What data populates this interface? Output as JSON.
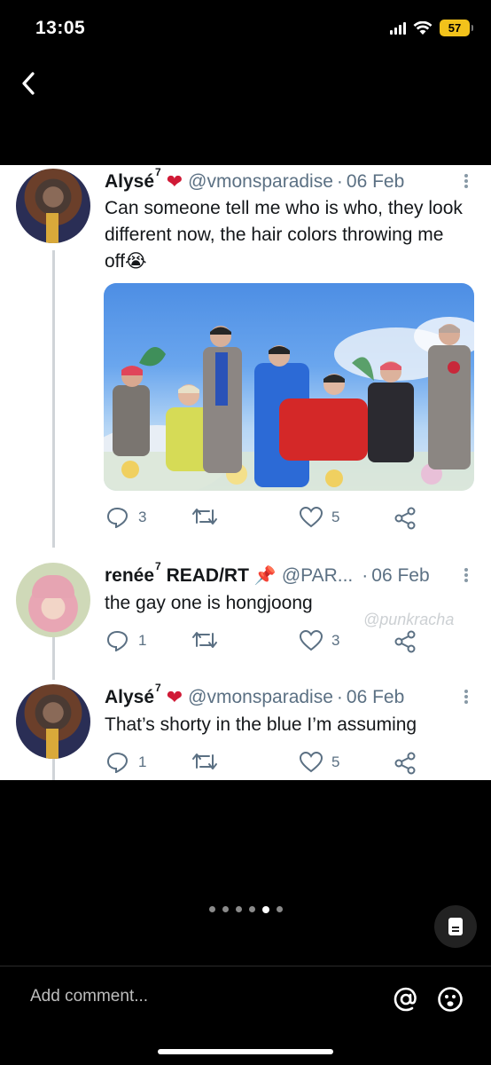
{
  "status_bar": {
    "time": "13:05",
    "battery": "57"
  },
  "tweets": [
    {
      "name": "Alysé",
      "name_sup": "7",
      "badge": "heart",
      "handle": "@vmonsparadise",
      "separator": "·",
      "date": "06 Feb",
      "text": "Can someone tell me who is who, they look different now, the hair colors throwing me off😭",
      "replies": "3",
      "likes": "5"
    },
    {
      "name": "renée",
      "name_sup": "7",
      "name_rest": " READ/RT",
      "badge": "pin",
      "handle": "@PAR...",
      "separator": "·",
      "date": "06 Feb",
      "text": "the gay one is hongjoong",
      "replies": "1",
      "likes": "3"
    },
    {
      "name": "Alysé",
      "name_sup": "7",
      "badge": "heart",
      "handle": "@vmonsparadise",
      "separator": "·",
      "date": "06 Feb",
      "text": "That’s shorty in the blue I’m assuming",
      "replies": "1",
      "likes": "5"
    }
  ],
  "watermark": "@punkracha",
  "pager": {
    "count": 6,
    "active_index": 4
  },
  "comment": {
    "placeholder": "Add comment..."
  },
  "colors": {
    "accent_heart": "#d01a36",
    "battery": "#f2c21b",
    "text_secondary": "#5b7083"
  },
  "icons": [
    "chevron-left-icon",
    "reply-icon",
    "retweet-icon",
    "like-icon",
    "share-icon",
    "more-icon",
    "document-icon",
    "at-icon",
    "emoji-icon"
  ]
}
